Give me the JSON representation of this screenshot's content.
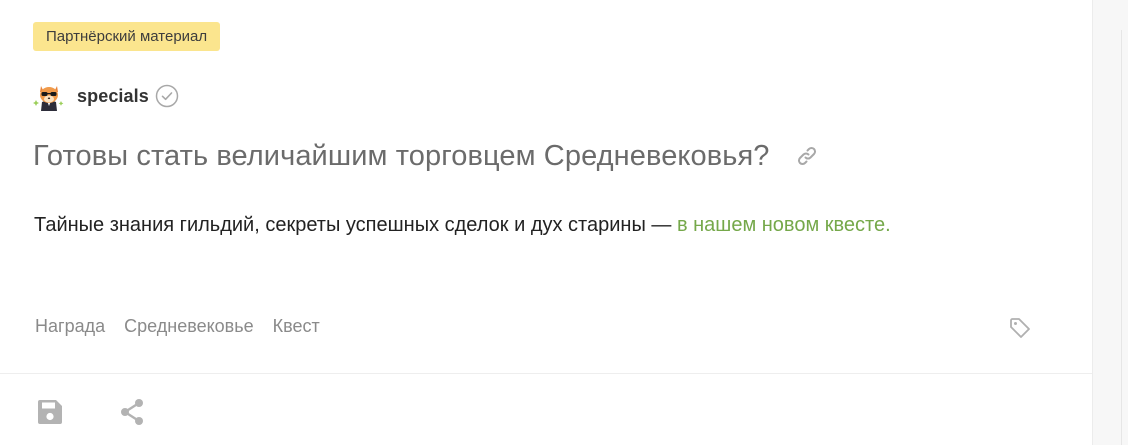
{
  "badge": {
    "label": "Партнёрский материал",
    "color": "#fbe58e"
  },
  "author": {
    "avatar_icon": "fox-in-sunglasses-avatar",
    "name": "specials",
    "verified_icon": "verified-check-icon"
  },
  "post": {
    "title": "Готовы стать величайшим торговцем Средневековья?",
    "link_icon": "link-icon",
    "lead_text": "Тайные знания гильдий, секреты успешных сделок и дух старины — ",
    "lead_link": "в нашем новом квесте.",
    "link_color": "#75a84a"
  },
  "tags": [
    {
      "label": "Награда"
    },
    {
      "label": "Средневековье"
    },
    {
      "label": "Квест"
    }
  ],
  "tag_icon": "tag-icon",
  "actions": {
    "save_icon": "save-icon",
    "share_icon": "share-icon"
  }
}
